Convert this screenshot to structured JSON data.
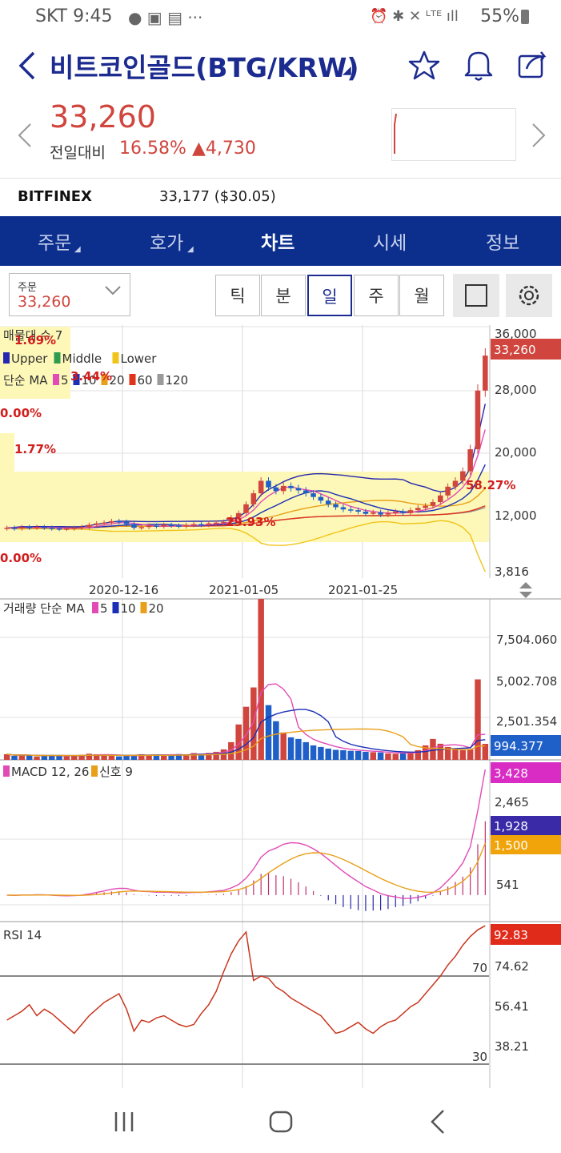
{
  "status_bar": {
    "carrier_time": "SKT 9:45",
    "battery": "55%"
  },
  "header": {
    "title": "비트코인골드(BTG/KRW)"
  },
  "price": {
    "value": "33,260",
    "change_label": "전일대비",
    "change_pct": "16.58%",
    "change_abs": "▲4,730"
  },
  "exchange": {
    "name": "BITFINEX",
    "value": "33,177 ($30.05)"
  },
  "tabs": [
    {
      "label": "주문",
      "has_menu": true
    },
    {
      "label": "호가",
      "has_menu": true
    },
    {
      "label": "차트",
      "has_menu": false,
      "active": true
    },
    {
      "label": "시세",
      "has_menu": false
    },
    {
      "label": "정보",
      "has_menu": false
    }
  ],
  "toolbar": {
    "order_label": "주문",
    "order_value": "33,260",
    "periods": [
      "틱",
      "분",
      "일",
      "주",
      "월"
    ],
    "active_period": "일"
  },
  "chart_data": [
    {
      "type": "candlestick",
      "title": "매물대 수 7",
      "bollinger_legend": [
        "Upper",
        "Middle",
        "Lower"
      ],
      "ma_legend_prefix": "단순 MA",
      "ma_periods": [
        "5",
        "10",
        "20",
        "60",
        "120"
      ],
      "y_ticks": [
        "36,000",
        "28,000",
        "20,000",
        "12,000",
        "3,816"
      ],
      "last_value": "33,260",
      "x_ticks": [
        "2020-12-16",
        "2021-01-05",
        "2021-01-25"
      ],
      "volume_profile_pct": [
        "1.69%",
        "3.44%",
        "0.00%",
        "1.77%",
        "58.27%",
        "29.93%",
        "0.00%"
      ],
      "colors": {
        "up": "#d0453d",
        "down": "#1f5fc8",
        "profile": "#fdf8b8",
        "upper": "#2626b0",
        "lower": "#f0c418",
        "ma5": "#e24bb6",
        "ma10": "#1a2fb5",
        "ma20": "#e8a019",
        "ma60": "#e0331c",
        "ma120": "#9a9a9a"
      },
      "closes": [
        9800,
        9700,
        9900,
        9800,
        9900,
        9800,
        9700,
        9650,
        9700,
        9800,
        9900,
        10200,
        10400,
        10500,
        10700,
        10600,
        10300,
        9800,
        9900,
        10100,
        10000,
        10200,
        10100,
        10000,
        10200,
        10300,
        10200,
        10400,
        10500,
        10600,
        11200,
        11800,
        13000,
        14500,
        16200,
        15300,
        14800,
        15500,
        15200,
        14900,
        14500,
        14000,
        13500,
        13000,
        12600,
        12300,
        12200,
        12000,
        11700,
        11900,
        11600,
        11800,
        12000,
        11800,
        12200,
        12500,
        12800,
        13300,
        14200,
        15400,
        16200,
        17500,
        20500,
        28500,
        33260
      ]
    },
    {
      "type": "bar",
      "title_prefix": "거래량 단순 MA",
      "ma_periods": [
        "5",
        "10",
        "20"
      ],
      "y_ticks": [
        "7,504.060",
        "5,002.708",
        "2,501.354"
      ],
      "last_value": "994.377",
      "values": [
        350,
        250,
        300,
        280,
        200,
        260,
        300,
        250,
        220,
        280,
        320,
        380,
        350,
        300,
        250,
        220,
        260,
        300,
        350,
        320,
        280,
        300,
        330,
        360,
        300,
        420,
        380,
        430,
        500,
        650,
        1100,
        2200,
        3300,
        4500,
        10000,
        3400,
        2400,
        1700,
        1400,
        1300,
        1100,
        900,
        800,
        700,
        620,
        600,
        560,
        550,
        500,
        480,
        460,
        400,
        380,
        420,
        500,
        600,
        900,
        1300,
        1000,
        800,
        700,
        600,
        650,
        5000,
        994
      ]
    },
    {
      "type": "line",
      "title": "MACD 12, 26",
      "signal_label": "신호 9",
      "y_ticks": [
        "2,465",
        "541"
      ],
      "last_values": {
        "macd": "3,428",
        "signal": "1,928",
        "histogram": "1,500"
      }
    },
    {
      "type": "line",
      "title": "RSI 14",
      "y_ticks": [
        "74.62",
        "56.41",
        "38.21"
      ],
      "levels": [
        "70",
        "30"
      ],
      "last_value": "92.83",
      "values": [
        50,
        52,
        54,
        57,
        52,
        55,
        53,
        50,
        47,
        44,
        48,
        52,
        55,
        58,
        60,
        62,
        55,
        45,
        50,
        49,
        51,
        52,
        50,
        48,
        47,
        48,
        53,
        57,
        63,
        72,
        80,
        86,
        90,
        68,
        70,
        69,
        65,
        63,
        60,
        58,
        56,
        54,
        52,
        48,
        44,
        45,
        47,
        49,
        46,
        44,
        47,
        49,
        50,
        53,
        56,
        58,
        62,
        66,
        70,
        75,
        79,
        84,
        88,
        91,
        92.83
      ]
    }
  ]
}
